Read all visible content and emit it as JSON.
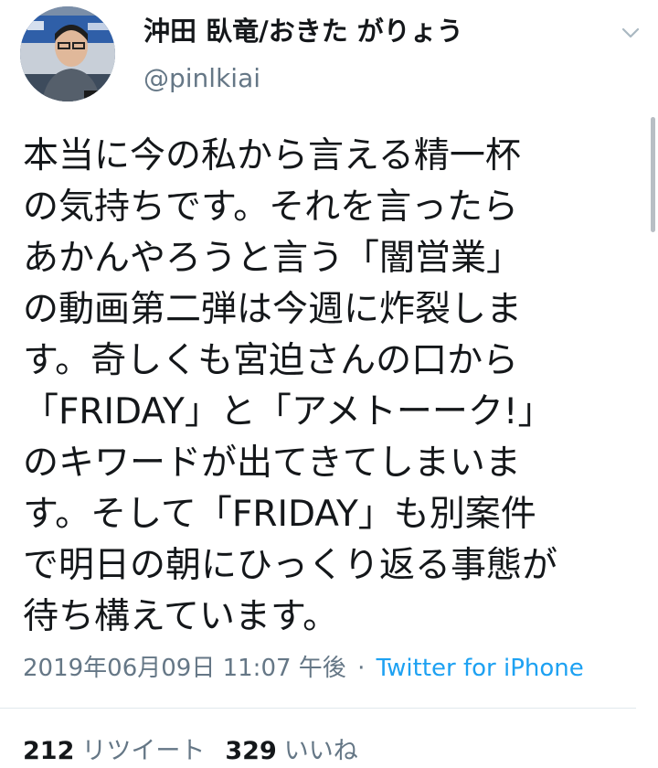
{
  "user": {
    "display_name": "沖田 臥竜/おきた がりょう",
    "handle": "@pinlkiai",
    "avatar_icon": "user-avatar-photo"
  },
  "menu": {
    "icon": "chevron-down-icon"
  },
  "tweet": {
    "lines": [
      "本当に今の私から言える精一杯",
      "の気持ちです。それを言ったら",
      "あかんやろうと言う「闇営業」",
      "の動画第二弾は今週に炸裂しま",
      "す。奇しくも宮迫さんの口から",
      "「FRIDAY」と「アメトーーク!」",
      "のキワードが出てきてしまいま",
      "す。そして「FRIDAY」も別案件",
      "で明日の朝にひっくり返る事態が",
      "待ち構えています。"
    ]
  },
  "meta": {
    "timestamp": "2019年06月09日 11:07 午後",
    "separator": "·",
    "source": "Twitter for iPhone"
  },
  "stats": {
    "retweets_count": "212",
    "retweets_label": "リツイート",
    "likes_count": "329",
    "likes_label": "いいね"
  },
  "colors": {
    "text": "#14171a",
    "secondary": "#657786",
    "link": "#1da1f2",
    "divider": "#e1e8ed"
  }
}
